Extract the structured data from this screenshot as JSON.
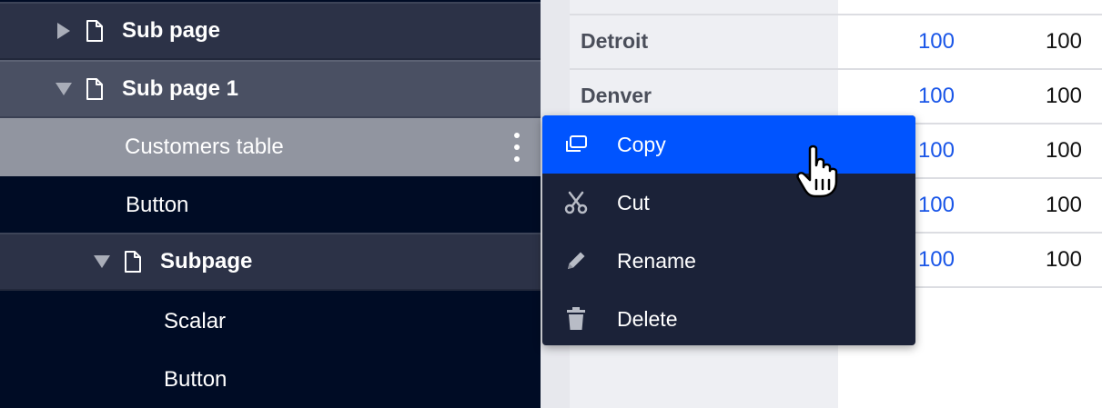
{
  "sidebar": {
    "items": [
      {
        "label": "Sub page"
      },
      {
        "label": "Sub page 1"
      },
      {
        "label": "Customers table"
      },
      {
        "label": "Button"
      },
      {
        "label": "Subpage"
      },
      {
        "label": "Scalar"
      },
      {
        "label": "Button"
      }
    ]
  },
  "table": {
    "rows": [
      {
        "name": "Detroit",
        "v1": "100",
        "v2": "100"
      },
      {
        "name": "Denver",
        "v1": "100",
        "v2": "100"
      },
      {
        "name": "",
        "v1": "100",
        "v2": "100"
      },
      {
        "name": "",
        "v1": "100",
        "v2": "100"
      },
      {
        "name": "",
        "v1": "100",
        "v2": "100"
      }
    ]
  },
  "context_menu": {
    "items": [
      {
        "label": "Copy",
        "icon": "copy-icon"
      },
      {
        "label": "Cut",
        "icon": "scissors-icon"
      },
      {
        "label": "Rename",
        "icon": "pencil-icon"
      },
      {
        "label": "Delete",
        "icon": "trash-icon"
      }
    ]
  },
  "colors": {
    "sidebar_bg": "#000c25",
    "menu_bg": "#1b2238",
    "menu_highlight": "#0054ff",
    "link_value": "#1a56e8"
  }
}
